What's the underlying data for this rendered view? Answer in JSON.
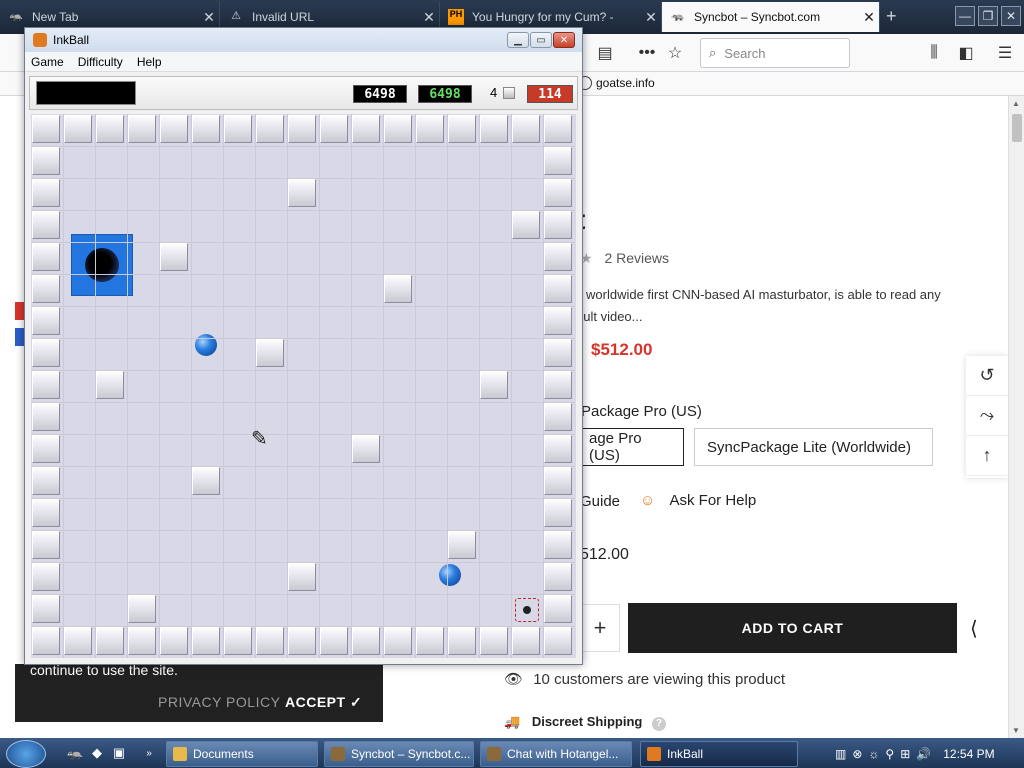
{
  "browser": {
    "tabs": [
      {
        "label": "New Tab",
        "icon": "🦡"
      },
      {
        "label": "Invalid URL",
        "icon": "⚠"
      },
      {
        "label": "You Hungry for my Cum? - ",
        "icon": "PH"
      },
      {
        "label": "Syncbot – Syncbot.com",
        "icon": "🦡"
      }
    ],
    "new_tab": "+",
    "search_placeholder": "Search",
    "bookmark": "goatse.info"
  },
  "product": {
    "reviews": "2 Reviews",
    "desc_line1": "worldwide first CNN-based AI masturbator, is able to read any",
    "desc_line2": "dult video...",
    "price": "$512.00",
    "variant_label": "Package Pro (US)",
    "option_1": "age Pro (US)",
    "option_2": "SyncPackage Lite (Worldwide)",
    "guide": "Guide",
    "help": "Ask For Help",
    "subtotal": "512.00",
    "qty_plus": "+",
    "add_to_cart": "ADD TO CART",
    "viewing": "10 customers are viewing this product",
    "shipping": "Discreet Shipping",
    "title_frag": "t"
  },
  "cookie": {
    "text": "continue to use the site.",
    "privacy": "PRIVACY POLICY",
    "accept": "ACCEPT ✓"
  },
  "inkball": {
    "title": "InkBall",
    "menu": [
      "Game",
      "Difficulty",
      "Help"
    ],
    "score1": "6498",
    "score2": "6498",
    "balls_left": "4",
    "timer": "114"
  },
  "taskbar": {
    "items": [
      {
        "label": "Documents"
      },
      {
        "label": "Syncbot – Syncbot.c..."
      },
      {
        "label": "Chat with Hotangel..."
      },
      {
        "label": "InkBall"
      }
    ],
    "time": "12:54 PM"
  }
}
